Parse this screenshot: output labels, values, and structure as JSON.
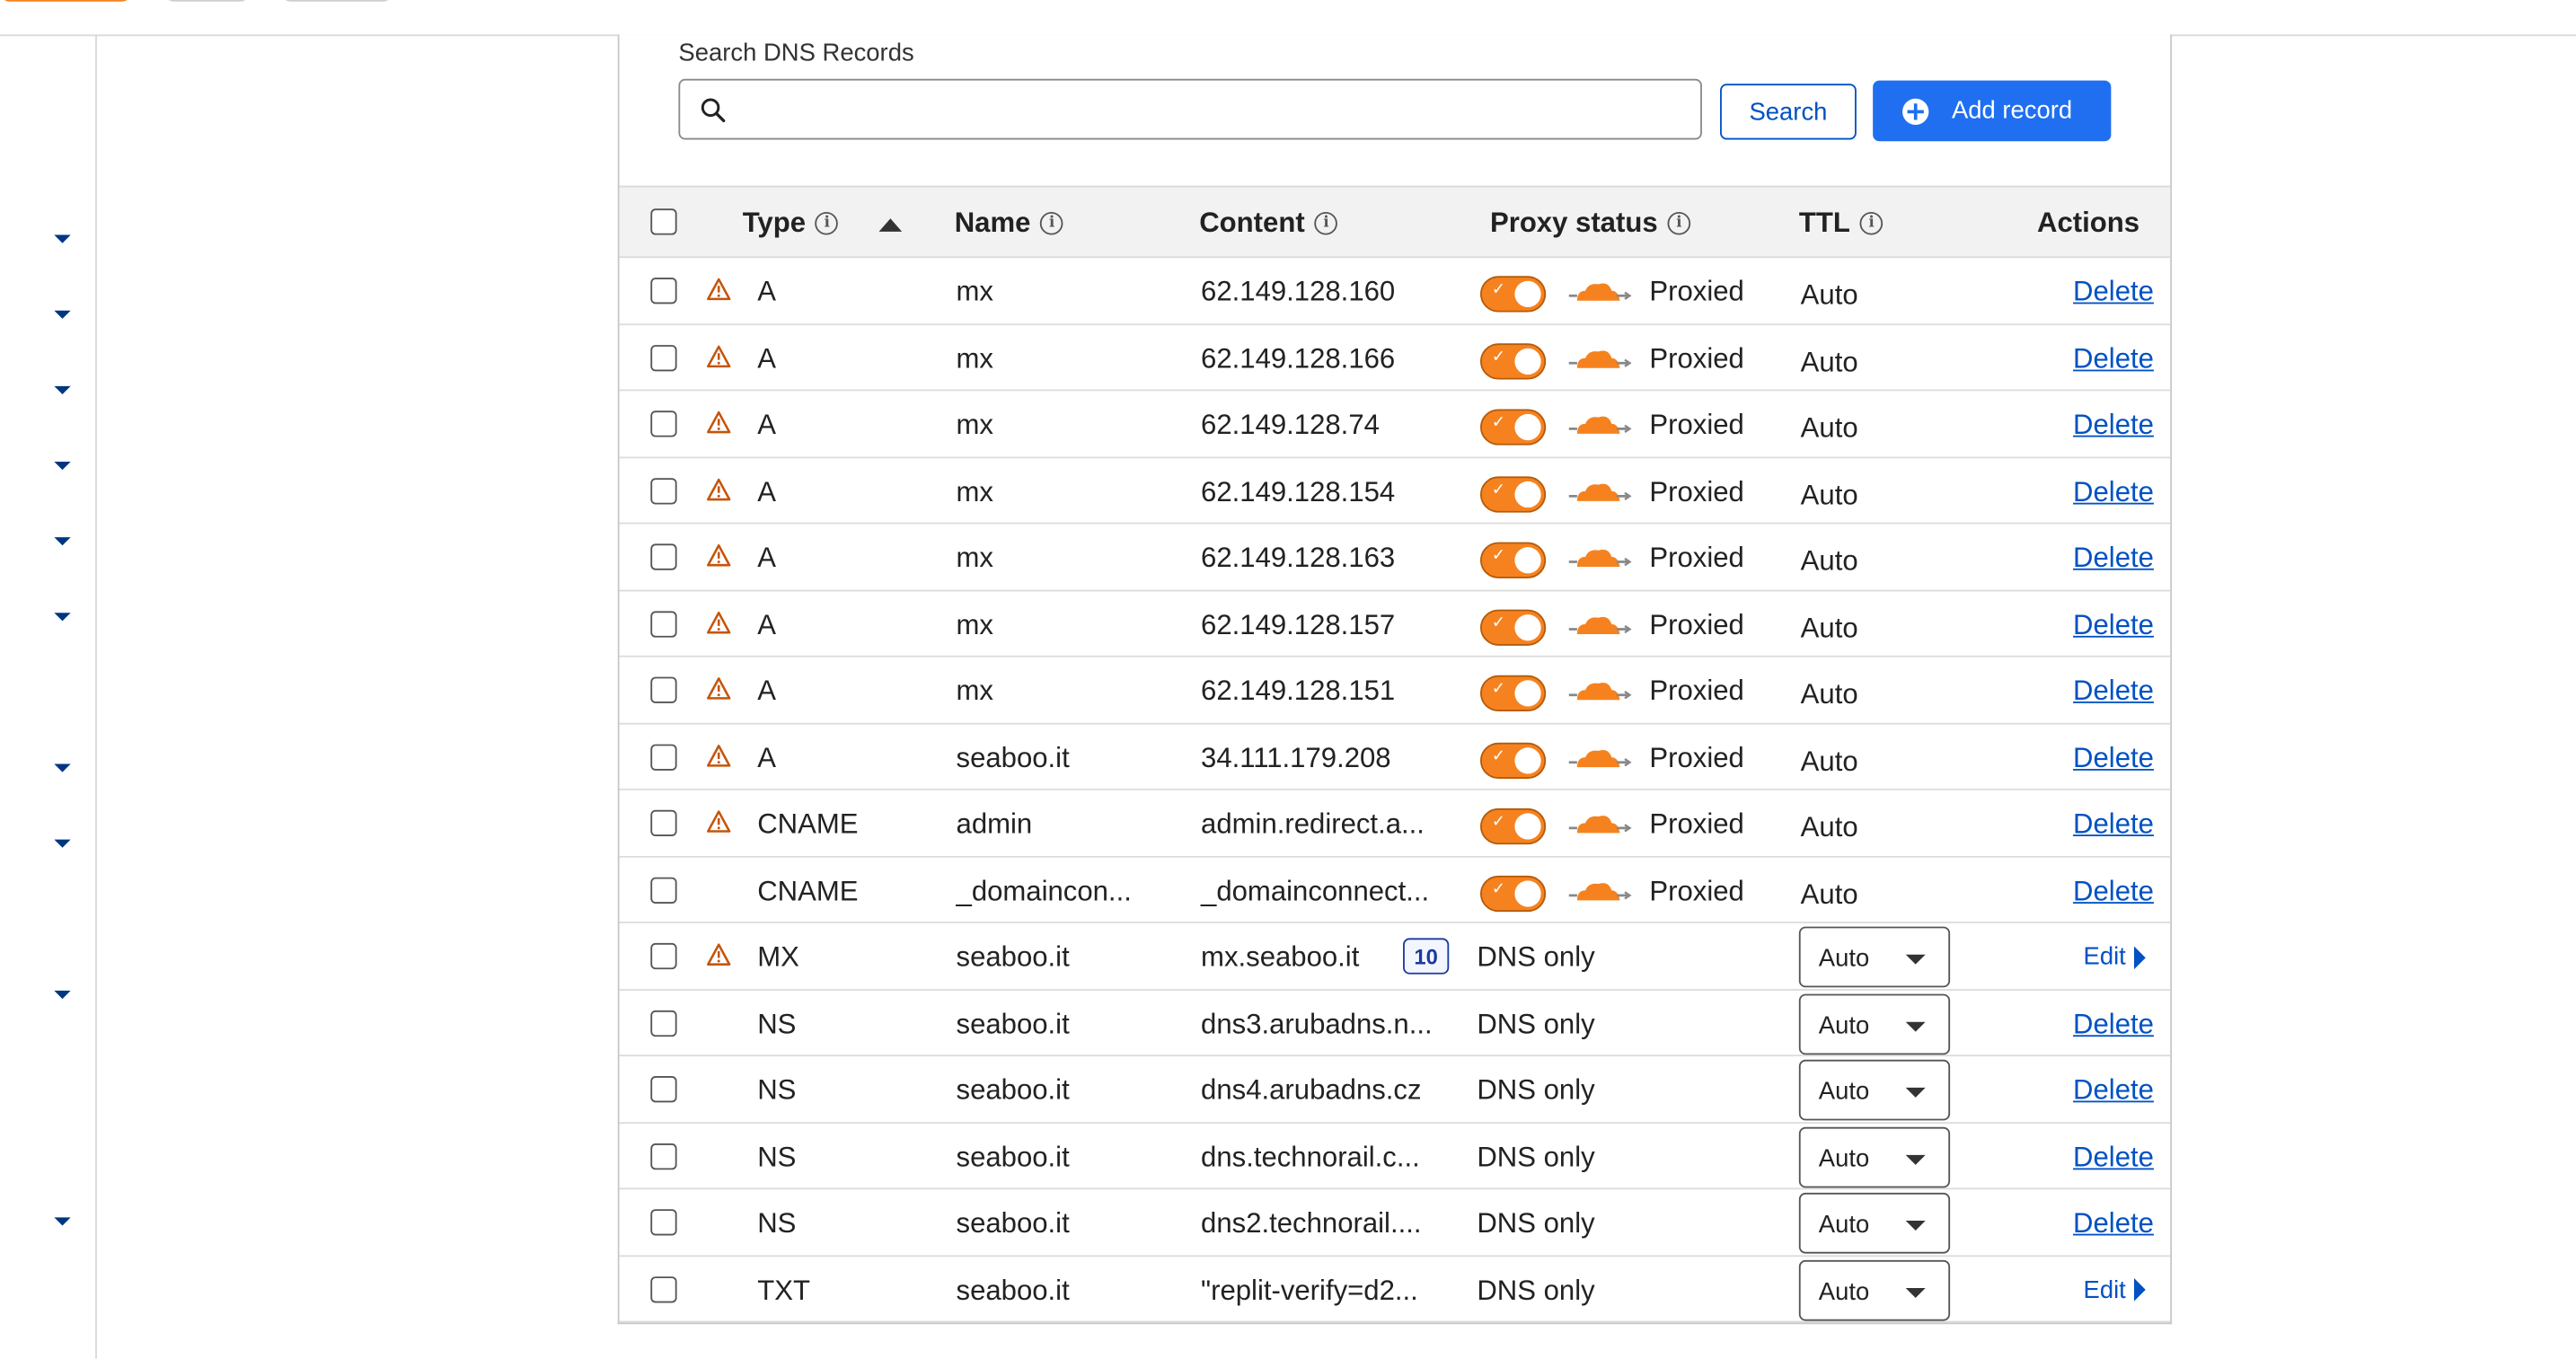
{
  "search": {
    "label": "Search DNS Records",
    "value": "",
    "placeholder": "",
    "button": "Search"
  },
  "add_record": {
    "label": "Add record"
  },
  "columns": {
    "type": "Type",
    "name": "Name",
    "content": "Content",
    "proxy": "Proxy status",
    "ttl": "TTL",
    "actions": "Actions"
  },
  "colors": {
    "accent": "#0051c3",
    "primary_button": "#1f6ff0",
    "proxy_orange": "#f6821f",
    "warning": "#c5550a"
  },
  "rows": [
    {
      "warn": true,
      "type": "A",
      "name": "mx",
      "content": "62.149.128.160",
      "proxied": true,
      "proxy": "Proxied",
      "ttl": "Auto",
      "action": "Delete"
    },
    {
      "warn": true,
      "type": "A",
      "name": "mx",
      "content": "62.149.128.166",
      "proxied": true,
      "proxy": "Proxied",
      "ttl": "Auto",
      "action": "Delete"
    },
    {
      "warn": true,
      "type": "A",
      "name": "mx",
      "content": "62.149.128.74",
      "proxied": true,
      "proxy": "Proxied",
      "ttl": "Auto",
      "action": "Delete"
    },
    {
      "warn": true,
      "type": "A",
      "name": "mx",
      "content": "62.149.128.154",
      "proxied": true,
      "proxy": "Proxied",
      "ttl": "Auto",
      "action": "Delete"
    },
    {
      "warn": true,
      "type": "A",
      "name": "mx",
      "content": "62.149.128.163",
      "proxied": true,
      "proxy": "Proxied",
      "ttl": "Auto",
      "action": "Delete"
    },
    {
      "warn": true,
      "type": "A",
      "name": "mx",
      "content": "62.149.128.157",
      "proxied": true,
      "proxy": "Proxied",
      "ttl": "Auto",
      "action": "Delete"
    },
    {
      "warn": true,
      "type": "A",
      "name": "mx",
      "content": "62.149.128.151",
      "proxied": true,
      "proxy": "Proxied",
      "ttl": "Auto",
      "action": "Delete"
    },
    {
      "warn": true,
      "type": "A",
      "name": "seaboo.it",
      "content": "34.111.179.208",
      "proxied": true,
      "proxy": "Proxied",
      "ttl": "Auto",
      "action": "Delete"
    },
    {
      "warn": true,
      "type": "CNAME",
      "name": "admin",
      "content": "admin.redirect.a...",
      "proxied": true,
      "proxy": "Proxied",
      "ttl": "Auto",
      "action": "Delete"
    },
    {
      "warn": false,
      "type": "CNAME",
      "name": "_domaincon...",
      "content": "_domainconnect...",
      "proxied": true,
      "proxy": "Proxied",
      "ttl": "Auto",
      "action": "Delete"
    },
    {
      "warn": true,
      "type": "MX",
      "name": "seaboo.it",
      "content": "mx.seaboo.it",
      "priority": "10",
      "proxied": false,
      "proxy": "DNS only",
      "ttl": "Auto",
      "action": "Edit",
      "ttl_select": true
    },
    {
      "warn": false,
      "type": "NS",
      "name": "seaboo.it",
      "content": "dns3.arubadns.n...",
      "proxied": false,
      "proxy": "DNS only",
      "ttl": "Auto",
      "action": "Delete",
      "ttl_select": true
    },
    {
      "warn": false,
      "type": "NS",
      "name": "seaboo.it",
      "content": "dns4.arubadns.cz",
      "proxied": false,
      "proxy": "DNS only",
      "ttl": "Auto",
      "action": "Delete",
      "ttl_select": true
    },
    {
      "warn": false,
      "type": "NS",
      "name": "seaboo.it",
      "content": "dns.technorail.c...",
      "proxied": false,
      "proxy": "DNS only",
      "ttl": "Auto",
      "action": "Delete",
      "ttl_select": true
    },
    {
      "warn": false,
      "type": "NS",
      "name": "seaboo.it",
      "content": "dns2.technorail....",
      "proxied": false,
      "proxy": "DNS only",
      "ttl": "Auto",
      "action": "Delete",
      "ttl_select": true
    },
    {
      "warn": false,
      "type": "TXT",
      "name": "seaboo.it",
      "content": "\"replit-verify=d2...",
      "proxied": false,
      "proxy": "DNS only",
      "ttl": "Auto",
      "action": "Edit",
      "ttl_select": true
    }
  ]
}
